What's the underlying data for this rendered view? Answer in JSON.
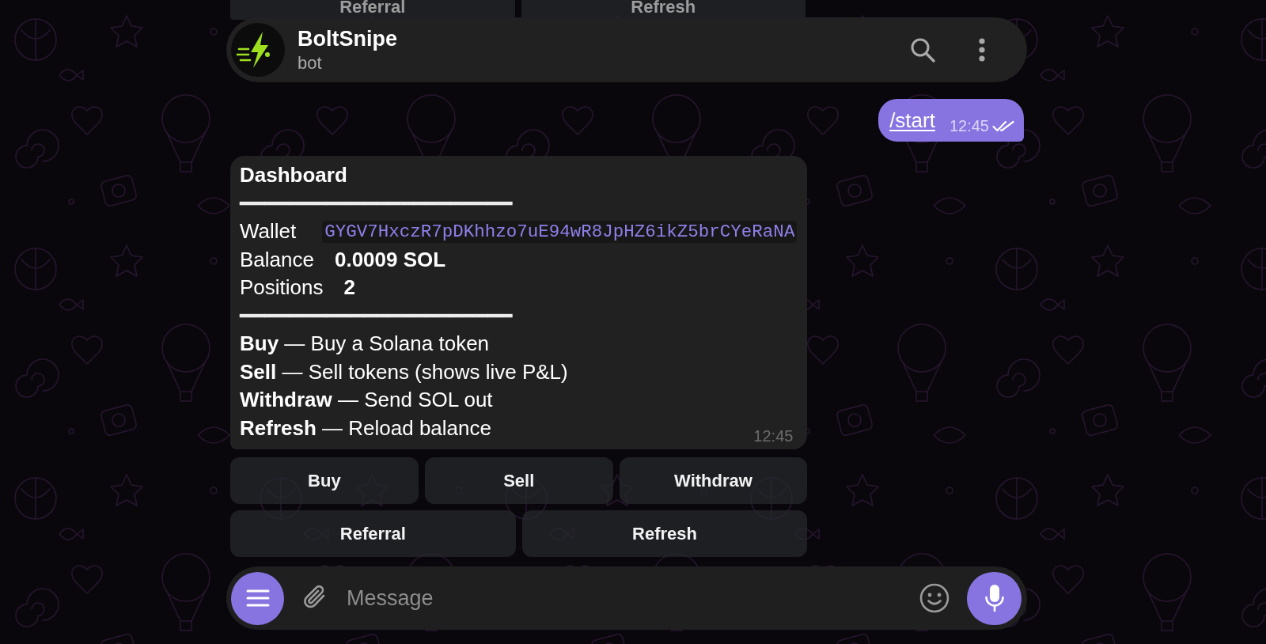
{
  "earlier_keyboard": [
    {
      "label": "Referral"
    },
    {
      "label": "Refresh"
    }
  ],
  "header": {
    "title": "BoltSnipe",
    "subtitle": "bot"
  },
  "messages": [
    {
      "kind": "outgoing",
      "text": "/start",
      "time": "12:45",
      "read": true
    },
    {
      "kind": "incoming",
      "lines": [
        {
          "kind": "title",
          "text": "Dashboard"
        },
        {
          "kind": "rule",
          "text": "━━━━━━━━━━━━━━━━━━━━━━"
        },
        {
          "kind": "field",
          "label": "Wallet",
          "value": {
            "kind": "code",
            "text": "GYGV7HxczR7pDKhhzo7uE94wR8JpHZ6ikZ5brCYeRaNA"
          }
        },
        {
          "kind": "field",
          "label": "Balance",
          "value": {
            "kind": "bold",
            "text": "0.0009 SOL"
          }
        },
        {
          "kind": "field",
          "label": "Positions",
          "value": {
            "kind": "bold",
            "text": "2"
          }
        },
        {
          "kind": "rule",
          "text": "━━━━━━━━━━━━━━━━━━━━━━"
        },
        {
          "kind": "text",
          "text": "**Buy** — Buy a Solana token"
        },
        {
          "kind": "text",
          "text": "**Sell** — Sell tokens (shows live P&L)"
        },
        {
          "kind": "text",
          "text": "**Withdraw** — Send SOL out"
        },
        {
          "kind": "text",
          "text": "**Refresh** — Reload balance"
        }
      ],
      "time": "12:45",
      "keyboard": [
        [
          {
            "label": "Buy"
          },
          {
            "label": "Sell"
          },
          {
            "label": "Withdraw"
          }
        ],
        [
          {
            "label": "Referral"
          },
          {
            "label": "Refresh"
          }
        ]
      ]
    }
  ],
  "composer": {
    "placeholder": "Message"
  }
}
